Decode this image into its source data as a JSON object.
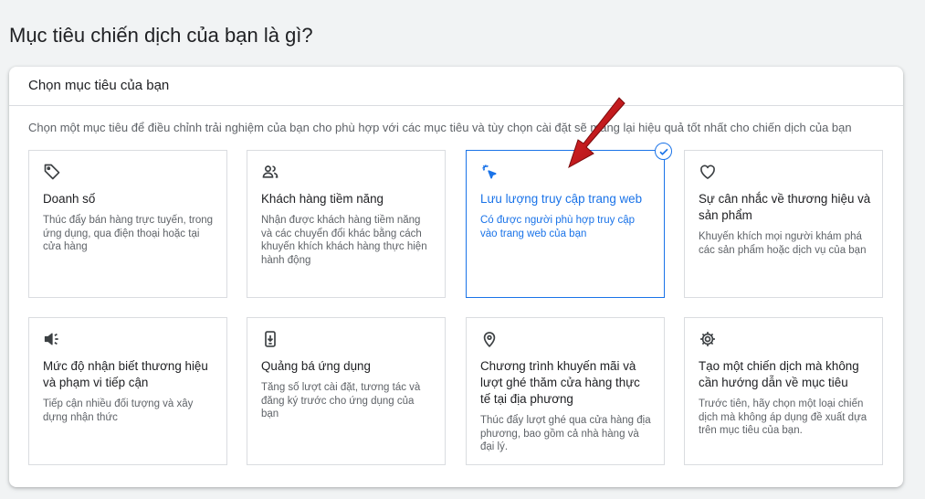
{
  "page_title": "Mục tiêu chiến dịch của bạn là gì?",
  "panel": {
    "header": "Chọn mục tiêu của bạn",
    "instruction": "Chọn một mục tiêu để điều chỉnh trải nghiệm của bạn cho phù hợp với các mục tiêu và tùy chọn cài đặt sẽ mang lại hiệu quả tốt nhất cho chiến dịch của bạn"
  },
  "goals": [
    {
      "icon": "tag-icon",
      "title": "Doanh số",
      "desc": "Thúc đẩy bán hàng trực tuyến, trong ứng dụng, qua điện thoại hoặc tại cửa hàng",
      "selected": false
    },
    {
      "icon": "people-icon",
      "title": "Khách hàng tiềm năng",
      "desc": "Nhận được khách hàng tiềm năng và các chuyển đổi khác bằng cách khuyến khích khách hàng thực hiện hành động",
      "selected": false
    },
    {
      "icon": "cursor-click-icon",
      "title": "Lưu lượng truy cập trang web",
      "desc": "Có được người phù hợp truy cập vào trang web của bạn",
      "selected": true
    },
    {
      "icon": "heart-icon",
      "title": "Sự cân nhắc về thương hiệu và sản phẩm",
      "desc": "Khuyến khích mọi người khám phá các sản phẩm hoặc dịch vụ của bạn",
      "selected": false
    },
    {
      "icon": "megaphone-icon",
      "title": "Mức độ nhận biết thương hiệu và phạm vi tiếp cận",
      "desc": "Tiếp cận nhiều đối tượng và xây dựng nhận thức",
      "selected": false
    },
    {
      "icon": "phone-download-icon",
      "title": "Quảng bá ứng dụng",
      "desc": "Tăng số lượt cài đặt, tương tác và đăng ký trước cho ứng dụng của bạn",
      "selected": false
    },
    {
      "icon": "location-pin-icon",
      "title": "Chương trình khuyến mãi và lượt ghé thăm cửa hàng thực tế tại địa phương",
      "desc": "Thúc đẩy lượt ghé qua cửa hàng địa phương, bao gồm cả nhà hàng và đại lý.",
      "selected": false
    },
    {
      "icon": "gear-icon",
      "title": "Tạo một chiến dịch mà không cần hướng dẫn về mục tiêu",
      "desc": "Trước tiên, hãy chọn một loại chiến dịch mà không áp dụng đề xuất dựa trên mục tiêu của bạn.",
      "selected": false
    }
  ],
  "colors": {
    "accent": "#1a73e8",
    "annotation_arrow": "#c8161d"
  }
}
